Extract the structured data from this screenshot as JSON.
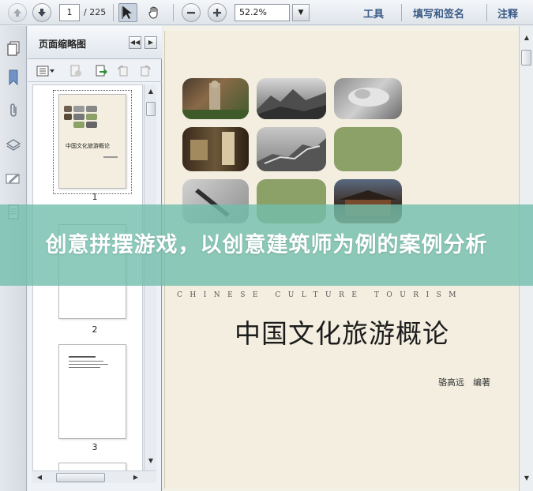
{
  "toolbar": {
    "current_page": "1",
    "total_pages": "/ 225",
    "zoom": "52.2%",
    "tools_label": "工具",
    "sign_label": "填写和签名",
    "comment_label": "注释"
  },
  "sidebar": {
    "title": "页面缩略图",
    "thumbnails": [
      {
        "num": "1",
        "title": "中国文化旅游概论"
      },
      {
        "num": "2"
      },
      {
        "num": "3"
      }
    ]
  },
  "document": {
    "subtitle_en": "CHINESE CULTURE TOURISM",
    "title_cn": "中国文化旅游概论",
    "author": "骆高远　编著"
  },
  "overlay": {
    "headline": "创意拼摆游戏，以创意建筑师为例的案例分析",
    "color": "#72beac"
  }
}
